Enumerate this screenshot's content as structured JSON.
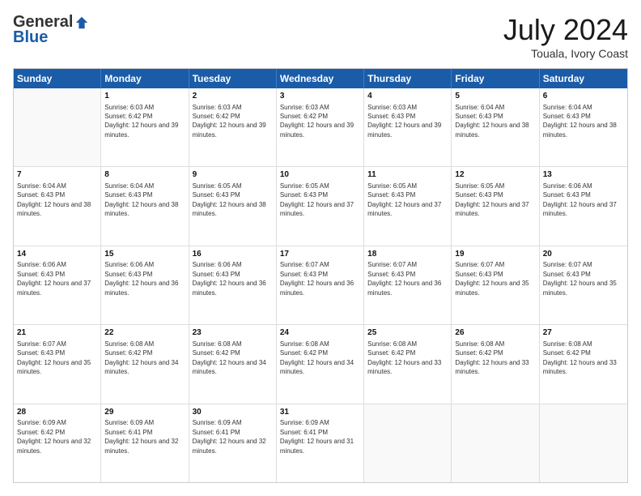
{
  "logo": {
    "general": "General",
    "blue": "Blue"
  },
  "title": "July 2024",
  "location": "Touala, Ivory Coast",
  "weekdays": [
    "Sunday",
    "Monday",
    "Tuesday",
    "Wednesday",
    "Thursday",
    "Friday",
    "Saturday"
  ],
  "weeks": [
    [
      {
        "day": null,
        "sunrise": null,
        "sunset": null,
        "daylight": null
      },
      {
        "day": "1",
        "sunrise": "Sunrise: 6:03 AM",
        "sunset": "Sunset: 6:42 PM",
        "daylight": "Daylight: 12 hours and 39 minutes."
      },
      {
        "day": "2",
        "sunrise": "Sunrise: 6:03 AM",
        "sunset": "Sunset: 6:42 PM",
        "daylight": "Daylight: 12 hours and 39 minutes."
      },
      {
        "day": "3",
        "sunrise": "Sunrise: 6:03 AM",
        "sunset": "Sunset: 6:42 PM",
        "daylight": "Daylight: 12 hours and 39 minutes."
      },
      {
        "day": "4",
        "sunrise": "Sunrise: 6:03 AM",
        "sunset": "Sunset: 6:43 PM",
        "daylight": "Daylight: 12 hours and 39 minutes."
      },
      {
        "day": "5",
        "sunrise": "Sunrise: 6:04 AM",
        "sunset": "Sunset: 6:43 PM",
        "daylight": "Daylight: 12 hours and 38 minutes."
      },
      {
        "day": "6",
        "sunrise": "Sunrise: 6:04 AM",
        "sunset": "Sunset: 6:43 PM",
        "daylight": "Daylight: 12 hours and 38 minutes."
      }
    ],
    [
      {
        "day": "7",
        "sunrise": "Sunrise: 6:04 AM",
        "sunset": "Sunset: 6:43 PM",
        "daylight": "Daylight: 12 hours and 38 minutes."
      },
      {
        "day": "8",
        "sunrise": "Sunrise: 6:04 AM",
        "sunset": "Sunset: 6:43 PM",
        "daylight": "Daylight: 12 hours and 38 minutes."
      },
      {
        "day": "9",
        "sunrise": "Sunrise: 6:05 AM",
        "sunset": "Sunset: 6:43 PM",
        "daylight": "Daylight: 12 hours and 38 minutes."
      },
      {
        "day": "10",
        "sunrise": "Sunrise: 6:05 AM",
        "sunset": "Sunset: 6:43 PM",
        "daylight": "Daylight: 12 hours and 37 minutes."
      },
      {
        "day": "11",
        "sunrise": "Sunrise: 6:05 AM",
        "sunset": "Sunset: 6:43 PM",
        "daylight": "Daylight: 12 hours and 37 minutes."
      },
      {
        "day": "12",
        "sunrise": "Sunrise: 6:05 AM",
        "sunset": "Sunset: 6:43 PM",
        "daylight": "Daylight: 12 hours and 37 minutes."
      },
      {
        "day": "13",
        "sunrise": "Sunrise: 6:06 AM",
        "sunset": "Sunset: 6:43 PM",
        "daylight": "Daylight: 12 hours and 37 minutes."
      }
    ],
    [
      {
        "day": "14",
        "sunrise": "Sunrise: 6:06 AM",
        "sunset": "Sunset: 6:43 PM",
        "daylight": "Daylight: 12 hours and 37 minutes."
      },
      {
        "day": "15",
        "sunrise": "Sunrise: 6:06 AM",
        "sunset": "Sunset: 6:43 PM",
        "daylight": "Daylight: 12 hours and 36 minutes."
      },
      {
        "day": "16",
        "sunrise": "Sunrise: 6:06 AM",
        "sunset": "Sunset: 6:43 PM",
        "daylight": "Daylight: 12 hours and 36 minutes."
      },
      {
        "day": "17",
        "sunrise": "Sunrise: 6:07 AM",
        "sunset": "Sunset: 6:43 PM",
        "daylight": "Daylight: 12 hours and 36 minutes."
      },
      {
        "day": "18",
        "sunrise": "Sunrise: 6:07 AM",
        "sunset": "Sunset: 6:43 PM",
        "daylight": "Daylight: 12 hours and 36 minutes."
      },
      {
        "day": "19",
        "sunrise": "Sunrise: 6:07 AM",
        "sunset": "Sunset: 6:43 PM",
        "daylight": "Daylight: 12 hours and 35 minutes."
      },
      {
        "day": "20",
        "sunrise": "Sunrise: 6:07 AM",
        "sunset": "Sunset: 6:43 PM",
        "daylight": "Daylight: 12 hours and 35 minutes."
      }
    ],
    [
      {
        "day": "21",
        "sunrise": "Sunrise: 6:07 AM",
        "sunset": "Sunset: 6:43 PM",
        "daylight": "Daylight: 12 hours and 35 minutes."
      },
      {
        "day": "22",
        "sunrise": "Sunrise: 6:08 AM",
        "sunset": "Sunset: 6:42 PM",
        "daylight": "Daylight: 12 hours and 34 minutes."
      },
      {
        "day": "23",
        "sunrise": "Sunrise: 6:08 AM",
        "sunset": "Sunset: 6:42 PM",
        "daylight": "Daylight: 12 hours and 34 minutes."
      },
      {
        "day": "24",
        "sunrise": "Sunrise: 6:08 AM",
        "sunset": "Sunset: 6:42 PM",
        "daylight": "Daylight: 12 hours and 34 minutes."
      },
      {
        "day": "25",
        "sunrise": "Sunrise: 6:08 AM",
        "sunset": "Sunset: 6:42 PM",
        "daylight": "Daylight: 12 hours and 33 minutes."
      },
      {
        "day": "26",
        "sunrise": "Sunrise: 6:08 AM",
        "sunset": "Sunset: 6:42 PM",
        "daylight": "Daylight: 12 hours and 33 minutes."
      },
      {
        "day": "27",
        "sunrise": "Sunrise: 6:08 AM",
        "sunset": "Sunset: 6:42 PM",
        "daylight": "Daylight: 12 hours and 33 minutes."
      }
    ],
    [
      {
        "day": "28",
        "sunrise": "Sunrise: 6:09 AM",
        "sunset": "Sunset: 6:42 PM",
        "daylight": "Daylight: 12 hours and 32 minutes."
      },
      {
        "day": "29",
        "sunrise": "Sunrise: 6:09 AM",
        "sunset": "Sunset: 6:41 PM",
        "daylight": "Daylight: 12 hours and 32 minutes."
      },
      {
        "day": "30",
        "sunrise": "Sunrise: 6:09 AM",
        "sunset": "Sunset: 6:41 PM",
        "daylight": "Daylight: 12 hours and 32 minutes."
      },
      {
        "day": "31",
        "sunrise": "Sunrise: 6:09 AM",
        "sunset": "Sunset: 6:41 PM",
        "daylight": "Daylight: 12 hours and 31 minutes."
      },
      {
        "day": null,
        "sunrise": null,
        "sunset": null,
        "daylight": null
      },
      {
        "day": null,
        "sunrise": null,
        "sunset": null,
        "daylight": null
      },
      {
        "day": null,
        "sunrise": null,
        "sunset": null,
        "daylight": null
      }
    ]
  ]
}
